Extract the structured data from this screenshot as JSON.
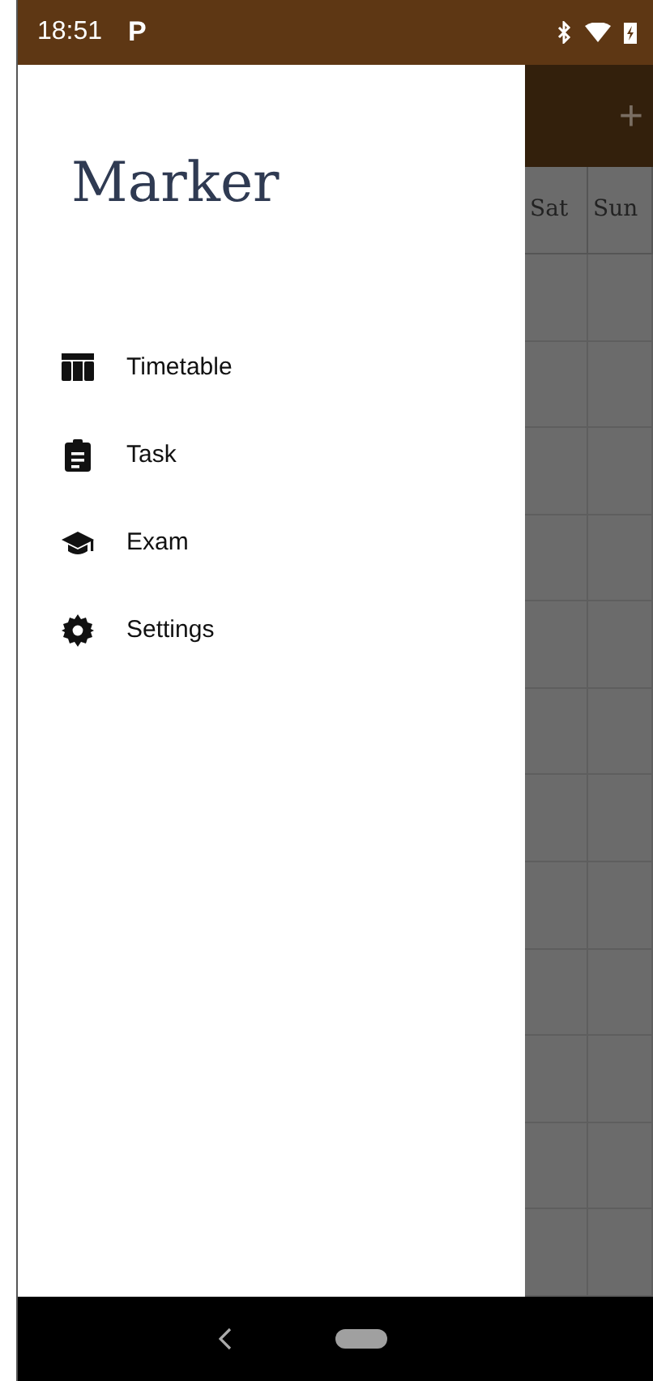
{
  "status_bar": {
    "time": "18:51",
    "notification": "P"
  },
  "drawer": {
    "title": "Marker",
    "items": [
      {
        "label": "Timetable"
      },
      {
        "label": "Task"
      },
      {
        "label": "Exam"
      },
      {
        "label": "Settings"
      }
    ]
  },
  "app_bar": {
    "add": "+"
  },
  "timetable": {
    "columns": [
      "Sat",
      "Sun"
    ]
  }
}
